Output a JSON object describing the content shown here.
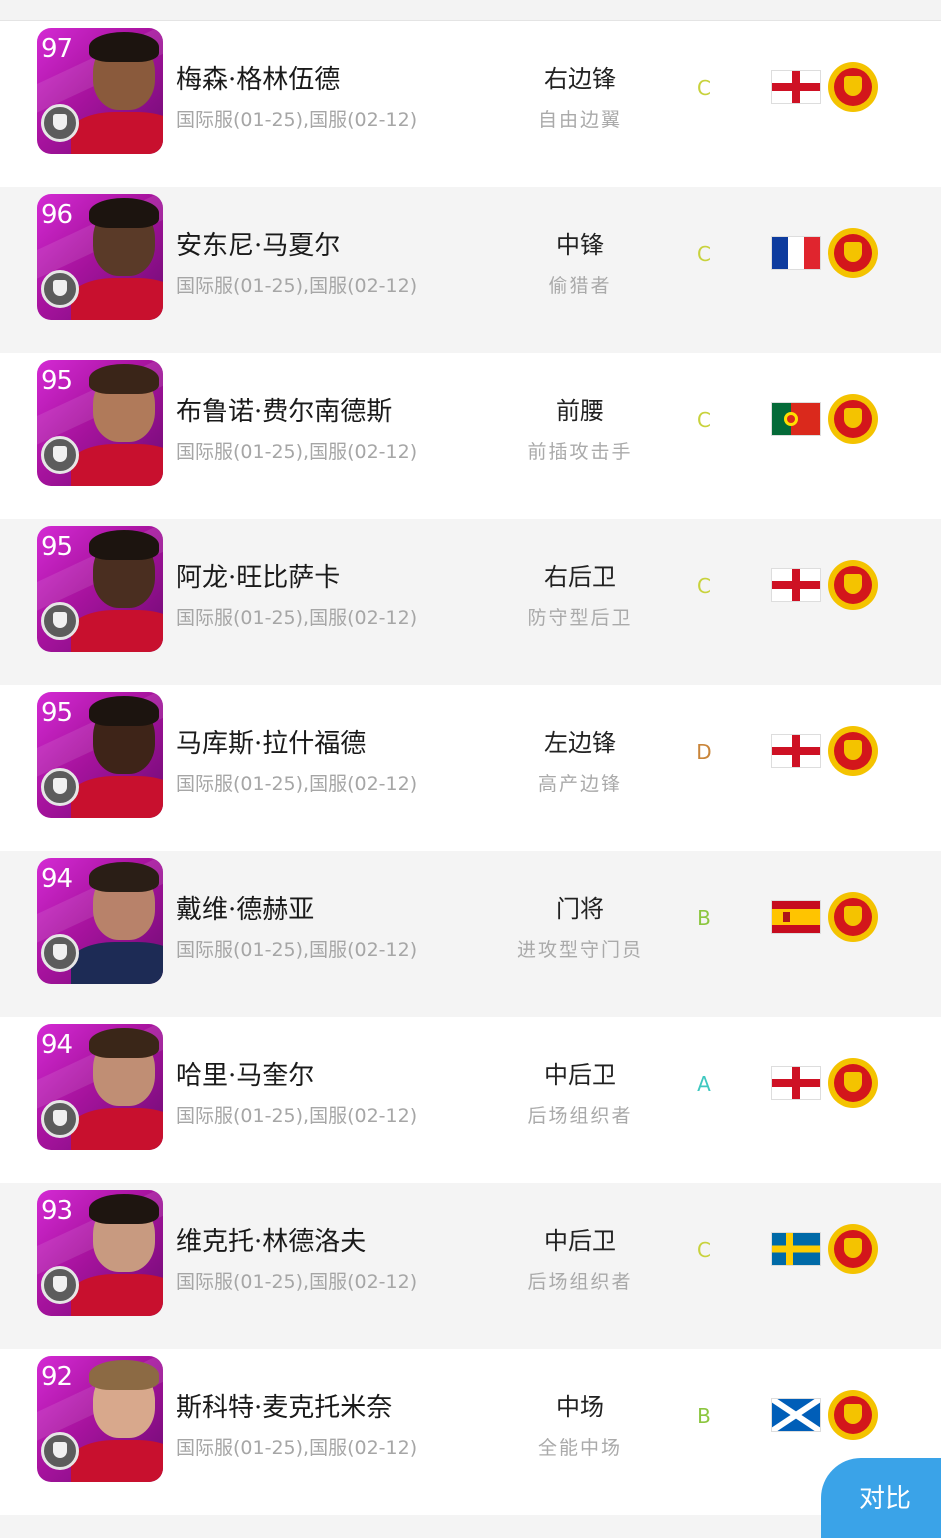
{
  "players": [
    {
      "rating": "97",
      "name": "梅森·格林伍德",
      "subtitle": "国际服(01-25),国服(02-12)",
      "position": "右边锋",
      "style": "自由边翼",
      "grade": "C",
      "grade_color": "#c8d23c",
      "flag": "england",
      "club_icon": "manchester-united-crest-icon"
    },
    {
      "rating": "96",
      "name": "安东尼·马夏尔",
      "subtitle": "国际服(01-25),国服(02-12)",
      "position": "中锋",
      "style": "偷猎者",
      "grade": "C",
      "grade_color": "#c8d23c",
      "flag": "france",
      "club_icon": "manchester-united-crest-icon"
    },
    {
      "rating": "95",
      "name": "布鲁诺·费尔南德斯",
      "subtitle": "国际服(01-25),国服(02-12)",
      "position": "前腰",
      "style": "前插攻击手",
      "grade": "C",
      "grade_color": "#c8d23c",
      "flag": "portugal",
      "club_icon": "manchester-united-crest-icon"
    },
    {
      "rating": "95",
      "name": "阿龙·旺比萨卡",
      "subtitle": "国际服(01-25),国服(02-12)",
      "position": "右后卫",
      "style": "防守型后卫",
      "grade": "C",
      "grade_color": "#c8d23c",
      "flag": "england",
      "club_icon": "manchester-united-crest-icon"
    },
    {
      "rating": "95",
      "name": "马库斯·拉什福德",
      "subtitle": "国际服(01-25),国服(02-12)",
      "position": "左边锋",
      "style": "高产边锋",
      "grade": "D",
      "grade_color": "#c9853a",
      "flag": "england",
      "club_icon": "manchester-united-crest-icon"
    },
    {
      "rating": "94",
      "name": "戴维·德赫亚",
      "subtitle": "国际服(01-25),国服(02-12)",
      "position": "门将",
      "style": "进攻型守门员",
      "grade": "B",
      "grade_color": "#8cc63f",
      "flag": "spain",
      "club_icon": "manchester-united-crest-icon"
    },
    {
      "rating": "94",
      "name": "哈里·马奎尔",
      "subtitle": "国际服(01-25),国服(02-12)",
      "position": "中后卫",
      "style": "后场组织者",
      "grade": "A",
      "grade_color": "#3fc8c0",
      "flag": "england",
      "club_icon": "manchester-united-crest-icon"
    },
    {
      "rating": "93",
      "name": "维克托·林德洛夫",
      "subtitle": "国际服(01-25),国服(02-12)",
      "position": "中后卫",
      "style": "后场组织者",
      "grade": "C",
      "grade_color": "#c8d23c",
      "flag": "sweden",
      "club_icon": "manchester-united-crest-icon"
    },
    {
      "rating": "92",
      "name": "斯科特·麦克托米奈",
      "subtitle": "国际服(01-25),国服(02-12)",
      "position": "中场",
      "style": "全能中场",
      "grade": "B",
      "grade_color": "#8cc63f",
      "flag": "scotland",
      "club_icon": "manchester-united-crest-icon"
    }
  ],
  "compare_button": {
    "label": "对比"
  }
}
